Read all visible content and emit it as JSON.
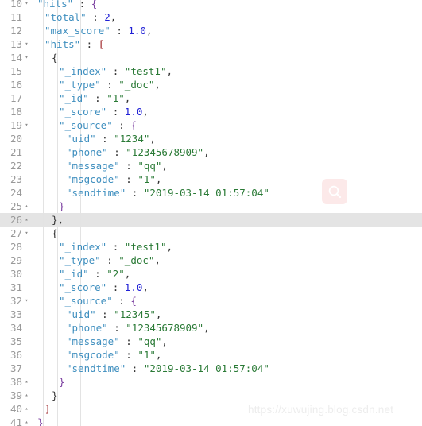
{
  "editor": {
    "first_visible_line": 10,
    "active_line": 26,
    "caret_line": 26,
    "colors": {
      "background": "#ffffff",
      "active_line": "#e4e4e4",
      "gutter_text": "#999999",
      "key": "#3f8fbf",
      "string": "#2a7a36",
      "number": "#2121d6",
      "punctuation": "#333333",
      "indent_guide": "#e3e3e3",
      "search_button_bg": "#fce9e9",
      "watermark": "#ededed"
    },
    "fold_markers": {
      "open": "▾",
      "closed": "▴"
    },
    "lines": [
      {
        "num": "10",
        "fold": "open",
        "indent": 1,
        "active": false,
        "tokens": [
          {
            "t": "k",
            "v": "\"hits\""
          },
          {
            "t": "p",
            "v": " : "
          },
          {
            "t": "b1",
            "v": "{"
          }
        ]
      },
      {
        "num": "11",
        "fold": "",
        "indent": 2,
        "active": false,
        "tokens": [
          {
            "t": "k",
            "v": "\"total\""
          },
          {
            "t": "p",
            "v": " : "
          },
          {
            "t": "n",
            "v": "2"
          },
          {
            "t": "p",
            "v": ","
          }
        ]
      },
      {
        "num": "12",
        "fold": "",
        "indent": 2,
        "active": false,
        "tokens": [
          {
            "t": "k",
            "v": "\"max_score\""
          },
          {
            "t": "p",
            "v": " : "
          },
          {
            "t": "n",
            "v": "1.0"
          },
          {
            "t": "p",
            "v": ","
          }
        ]
      },
      {
        "num": "13",
        "fold": "open",
        "indent": 2,
        "active": false,
        "tokens": [
          {
            "t": "k",
            "v": "\"hits\""
          },
          {
            "t": "p",
            "v": " : "
          },
          {
            "t": "b2",
            "v": "["
          }
        ]
      },
      {
        "num": "14",
        "fold": "open",
        "indent": 3,
        "active": false,
        "tokens": [
          {
            "t": "b3",
            "v": "{"
          }
        ]
      },
      {
        "num": "15",
        "fold": "",
        "indent": 4,
        "active": false,
        "tokens": [
          {
            "t": "k",
            "v": "\"_index\""
          },
          {
            "t": "p",
            "v": " : "
          },
          {
            "t": "s",
            "v": "\"test1\""
          },
          {
            "t": "p",
            "v": ","
          }
        ]
      },
      {
        "num": "16",
        "fold": "",
        "indent": 4,
        "active": false,
        "tokens": [
          {
            "t": "k",
            "v": "\"_type\""
          },
          {
            "t": "p",
            "v": " : "
          },
          {
            "t": "s",
            "v": "\"_doc\""
          },
          {
            "t": "p",
            "v": ","
          }
        ]
      },
      {
        "num": "17",
        "fold": "",
        "indent": 4,
        "active": false,
        "tokens": [
          {
            "t": "k",
            "v": "\"_id\""
          },
          {
            "t": "p",
            "v": " : "
          },
          {
            "t": "s",
            "v": "\"1\""
          },
          {
            "t": "p",
            "v": ","
          }
        ]
      },
      {
        "num": "18",
        "fold": "",
        "indent": 4,
        "active": false,
        "tokens": [
          {
            "t": "k",
            "v": "\"_score\""
          },
          {
            "t": "p",
            "v": " : "
          },
          {
            "t": "n",
            "v": "1.0"
          },
          {
            "t": "p",
            "v": ","
          }
        ]
      },
      {
        "num": "19",
        "fold": "open",
        "indent": 4,
        "active": false,
        "tokens": [
          {
            "t": "k",
            "v": "\"_source\""
          },
          {
            "t": "p",
            "v": " : "
          },
          {
            "t": "b1",
            "v": "{"
          }
        ]
      },
      {
        "num": "20",
        "fold": "",
        "indent": 5,
        "active": false,
        "tokens": [
          {
            "t": "k",
            "v": "\"uid\""
          },
          {
            "t": "p",
            "v": " : "
          },
          {
            "t": "s",
            "v": "\"1234\""
          },
          {
            "t": "p",
            "v": ","
          }
        ]
      },
      {
        "num": "21",
        "fold": "",
        "indent": 5,
        "active": false,
        "tokens": [
          {
            "t": "k",
            "v": "\"phone\""
          },
          {
            "t": "p",
            "v": " : "
          },
          {
            "t": "s",
            "v": "\"12345678909\""
          },
          {
            "t": "p",
            "v": ","
          }
        ]
      },
      {
        "num": "22",
        "fold": "",
        "indent": 5,
        "active": false,
        "tokens": [
          {
            "t": "k",
            "v": "\"message\""
          },
          {
            "t": "p",
            "v": " : "
          },
          {
            "t": "s",
            "v": "\"qq\""
          },
          {
            "t": "p",
            "v": ","
          }
        ]
      },
      {
        "num": "23",
        "fold": "",
        "indent": 5,
        "active": false,
        "tokens": [
          {
            "t": "k",
            "v": "\"msgcode\""
          },
          {
            "t": "p",
            "v": " : "
          },
          {
            "t": "s",
            "v": "\"1\""
          },
          {
            "t": "p",
            "v": ","
          }
        ]
      },
      {
        "num": "24",
        "fold": "",
        "indent": 5,
        "active": false,
        "tokens": [
          {
            "t": "k",
            "v": "\"sendtime\""
          },
          {
            "t": "p",
            "v": " : "
          },
          {
            "t": "s",
            "v": "\"2019-03-14 01:57:04\""
          }
        ]
      },
      {
        "num": "25",
        "fold": "closed",
        "indent": 4,
        "active": false,
        "tokens": [
          {
            "t": "b1",
            "v": "}"
          }
        ]
      },
      {
        "num": "26",
        "fold": "closed",
        "indent": 3,
        "active": true,
        "caret": true,
        "tokens": [
          {
            "t": "b3",
            "v": "}"
          },
          {
            "t": "p",
            "v": ","
          }
        ]
      },
      {
        "num": "27",
        "fold": "open",
        "indent": 3,
        "active": false,
        "tokens": [
          {
            "t": "b3",
            "v": "{"
          }
        ]
      },
      {
        "num": "28",
        "fold": "",
        "indent": 4,
        "active": false,
        "tokens": [
          {
            "t": "k",
            "v": "\"_index\""
          },
          {
            "t": "p",
            "v": " : "
          },
          {
            "t": "s",
            "v": "\"test1\""
          },
          {
            "t": "p",
            "v": ","
          }
        ]
      },
      {
        "num": "29",
        "fold": "",
        "indent": 4,
        "active": false,
        "tokens": [
          {
            "t": "k",
            "v": "\"_type\""
          },
          {
            "t": "p",
            "v": " : "
          },
          {
            "t": "s",
            "v": "\"_doc\""
          },
          {
            "t": "p",
            "v": ","
          }
        ]
      },
      {
        "num": "30",
        "fold": "",
        "indent": 4,
        "active": false,
        "tokens": [
          {
            "t": "k",
            "v": "\"_id\""
          },
          {
            "t": "p",
            "v": " : "
          },
          {
            "t": "s",
            "v": "\"2\""
          },
          {
            "t": "p",
            "v": ","
          }
        ]
      },
      {
        "num": "31",
        "fold": "",
        "indent": 4,
        "active": false,
        "tokens": [
          {
            "t": "k",
            "v": "\"_score\""
          },
          {
            "t": "p",
            "v": " : "
          },
          {
            "t": "n",
            "v": "1.0"
          },
          {
            "t": "p",
            "v": ","
          }
        ]
      },
      {
        "num": "32",
        "fold": "open",
        "indent": 4,
        "active": false,
        "tokens": [
          {
            "t": "k",
            "v": "\"_source\""
          },
          {
            "t": "p",
            "v": " : "
          },
          {
            "t": "b1",
            "v": "{"
          }
        ]
      },
      {
        "num": "33",
        "fold": "",
        "indent": 5,
        "active": false,
        "tokens": [
          {
            "t": "k",
            "v": "\"uid\""
          },
          {
            "t": "p",
            "v": " : "
          },
          {
            "t": "s",
            "v": "\"12345\""
          },
          {
            "t": "p",
            "v": ","
          }
        ]
      },
      {
        "num": "34",
        "fold": "",
        "indent": 5,
        "active": false,
        "tokens": [
          {
            "t": "k",
            "v": "\"phone\""
          },
          {
            "t": "p",
            "v": " : "
          },
          {
            "t": "s",
            "v": "\"12345678909\""
          },
          {
            "t": "p",
            "v": ","
          }
        ]
      },
      {
        "num": "35",
        "fold": "",
        "indent": 5,
        "active": false,
        "tokens": [
          {
            "t": "k",
            "v": "\"message\""
          },
          {
            "t": "p",
            "v": " : "
          },
          {
            "t": "s",
            "v": "\"qq\""
          },
          {
            "t": "p",
            "v": ","
          }
        ]
      },
      {
        "num": "36",
        "fold": "",
        "indent": 5,
        "active": false,
        "tokens": [
          {
            "t": "k",
            "v": "\"msgcode\""
          },
          {
            "t": "p",
            "v": " : "
          },
          {
            "t": "s",
            "v": "\"1\""
          },
          {
            "t": "p",
            "v": ","
          }
        ]
      },
      {
        "num": "37",
        "fold": "",
        "indent": 5,
        "active": false,
        "tokens": [
          {
            "t": "k",
            "v": "\"sendtime\""
          },
          {
            "t": "p",
            "v": " : "
          },
          {
            "t": "s",
            "v": "\"2019-03-14 01:57:04\""
          }
        ]
      },
      {
        "num": "38",
        "fold": "closed",
        "indent": 4,
        "active": false,
        "tokens": [
          {
            "t": "b1",
            "v": "}"
          }
        ]
      },
      {
        "num": "39",
        "fold": "closed",
        "indent": 3,
        "active": false,
        "tokens": [
          {
            "t": "b3",
            "v": "}"
          }
        ]
      },
      {
        "num": "40",
        "fold": "closed",
        "indent": 2,
        "active": false,
        "tokens": [
          {
            "t": "b2",
            "v": "]"
          }
        ]
      },
      {
        "num": "41",
        "fold": "closed",
        "indent": 1,
        "active": false,
        "tokens": [
          {
            "t": "b1",
            "v": "}"
          }
        ]
      }
    ],
    "indent_guide_x": [
      41,
      54,
      72,
      90,
      101,
      119
    ]
  },
  "search_button": {
    "icon": "search-icon",
    "label": "Search"
  },
  "watermark": {
    "text": "https://xuwujing.blog.csdn.net"
  }
}
